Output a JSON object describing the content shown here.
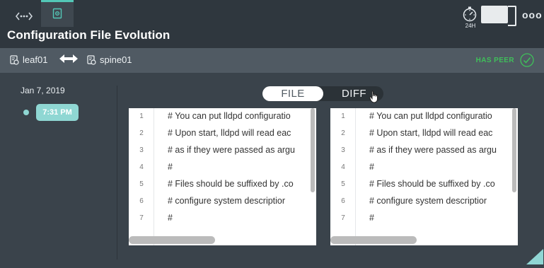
{
  "header": {
    "title": "Configuration File Evolution",
    "timer_label": "24H",
    "more_label": "ooo"
  },
  "devices": {
    "left": "leaf01",
    "right": "spine01",
    "peer_label": "HAS PEER"
  },
  "timeline": {
    "date": "Jan 7, 2019",
    "time": "7:31 PM"
  },
  "view_toggle": {
    "file": "FILE",
    "diff": "DIFF",
    "selected": "FILE"
  },
  "editor_lines": [
    {
      "n": "1",
      "text": "# You can put lldpd configuratio"
    },
    {
      "n": "2",
      "text": "# Upon start, lldpd will read eac"
    },
    {
      "n": "3",
      "text": "# as if they were passed as argu"
    },
    {
      "n": "4",
      "text": "#"
    },
    {
      "n": "5",
      "text": "# Files should be suffixed by .co"
    },
    {
      "n": "6",
      "text": "#   configure system descriptior"
    },
    {
      "n": "7",
      "text": "#"
    }
  ],
  "colors": {
    "accent": "#53c7b7",
    "time_pill": "#8fd7d3",
    "peer_green": "#3fbf5a"
  }
}
